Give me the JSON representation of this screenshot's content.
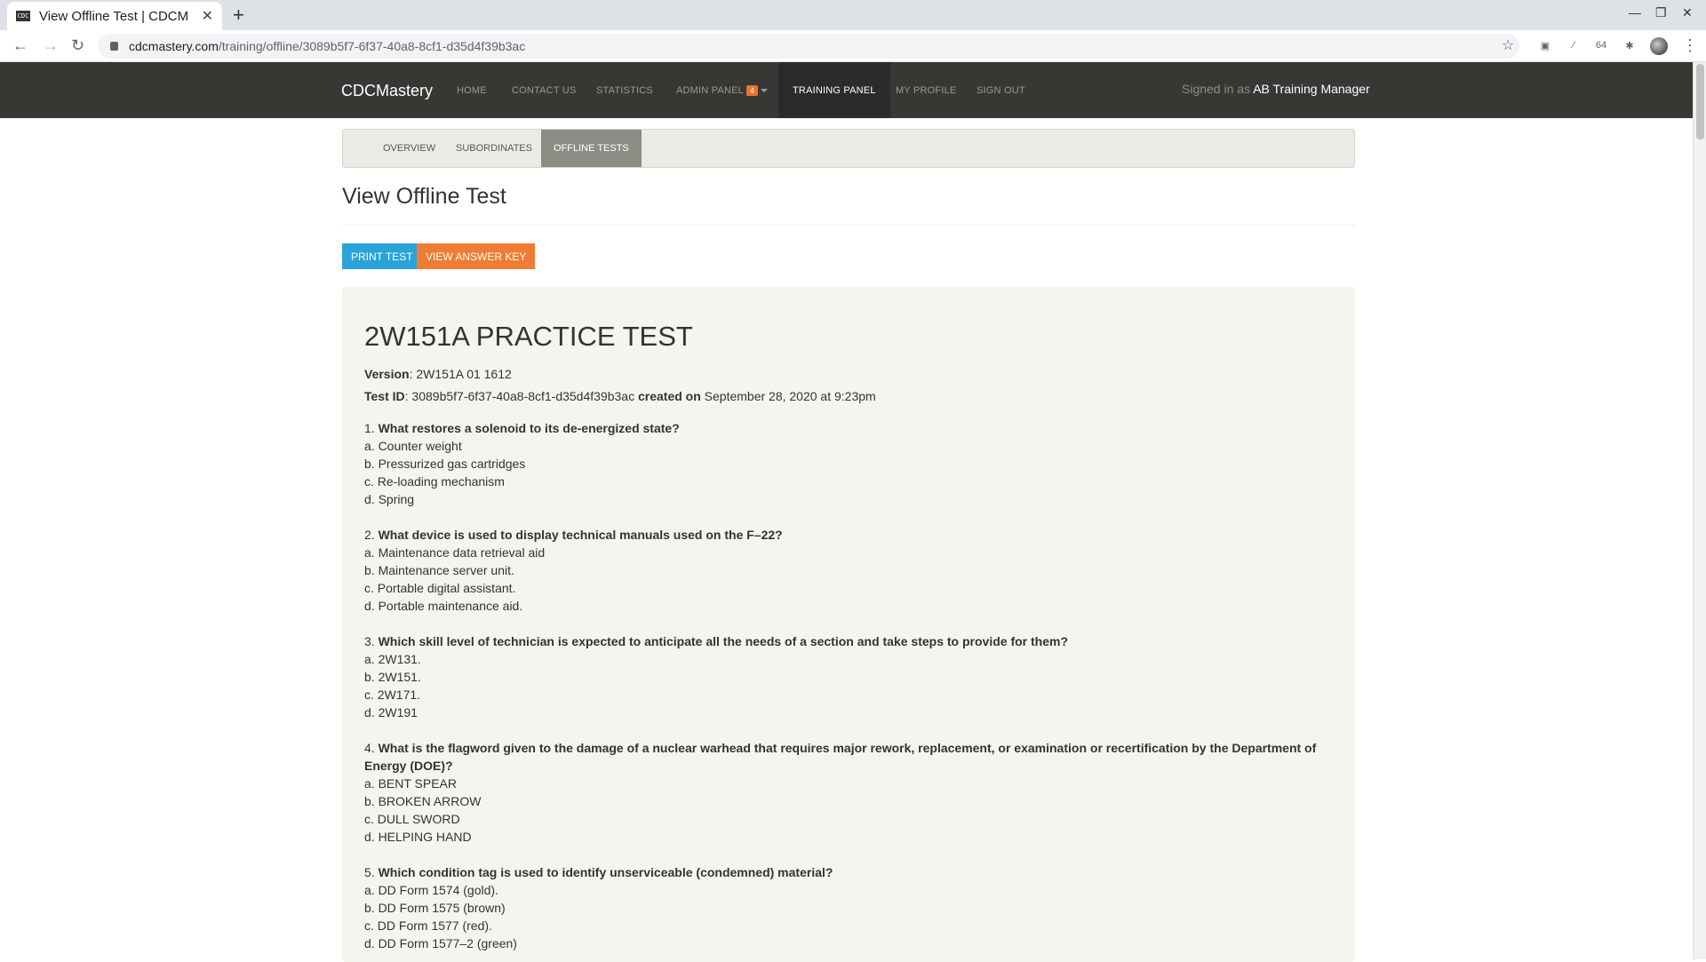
{
  "browser": {
    "tab_title": "View Offline Test | CDCM",
    "favicon_text": "CDC",
    "url_host": "cdcmastery.com",
    "url_path": "/training/offline/3089b5f7-6f37-40a8-8cf1-d35d4f39b3ac"
  },
  "nav": {
    "brand": "CDCMastery",
    "items": {
      "home": "HOME",
      "contact": "CONTACT US",
      "statistics": "STATISTICS",
      "admin": "ADMIN PANEL",
      "admin_badge": "4",
      "training": "TRAINING PANEL",
      "profile": "MY PROFILE",
      "signout": "SIGN OUT"
    },
    "signed_in_prefix": "Signed in as",
    "signed_in_user": "AB Training Manager"
  },
  "subnav": {
    "overview": "OVERVIEW",
    "subordinates": "SUBORDINATES",
    "offline_tests": "OFFLINE TESTS"
  },
  "page": {
    "heading": "View Offline Test",
    "print_button": "PRINT TEST",
    "answer_key_button": "VIEW ANSWER KEY"
  },
  "test": {
    "title": "2W151A PRACTICE TEST",
    "version_label": "Version",
    "version_value": "2W151A 01 1612",
    "id_label": "Test ID",
    "id_value": "3089b5f7-6f37-40a8-8cf1-d35d4f39b3ac",
    "created_label": "created on",
    "created_value": "September 28, 2020 at 9:23pm"
  },
  "questions": [
    {
      "num": "1.",
      "text": "What restores a solenoid to its de-energized state?",
      "answers": [
        "a. Counter weight",
        "b. Pressurized gas cartridges",
        "c. Re-loading mechanism",
        "d. Spring"
      ]
    },
    {
      "num": "2.",
      "text": "What device is used to display technical manuals used on the F–22?",
      "answers": [
        "a. Maintenance data retrieval aid",
        "b. Maintenance server unit.",
        "c. Portable digital assistant.",
        "d. Portable maintenance aid."
      ]
    },
    {
      "num": "3.",
      "text": "Which skill level of technician is expected to anticipate all the needs of a section and take steps to provide for them?",
      "answers": [
        "a. 2W131.",
        "b. 2W151.",
        "c. 2W171.",
        "d. 2W191"
      ]
    },
    {
      "num": "4.",
      "text": "What is the flagword given to the damage of a nuclear warhead that requires major rework, replacement, or examination or recertification by the Department of Energy (DOE)?",
      "answers": [
        "a. BENT SPEAR",
        "b. BROKEN ARROW",
        "c. DULL SWORD",
        "d. HELPING HAND"
      ]
    },
    {
      "num": "5.",
      "text": "Which condition tag is used to identify unserviceable (condemned) material?",
      "answers": [
        "a. DD Form 1574 (gold).",
        "b. DD Form 1575 (brown)",
        "c. DD Form 1577 (red).",
        "d. DD Form 1577–2 (green)"
      ]
    }
  ]
}
